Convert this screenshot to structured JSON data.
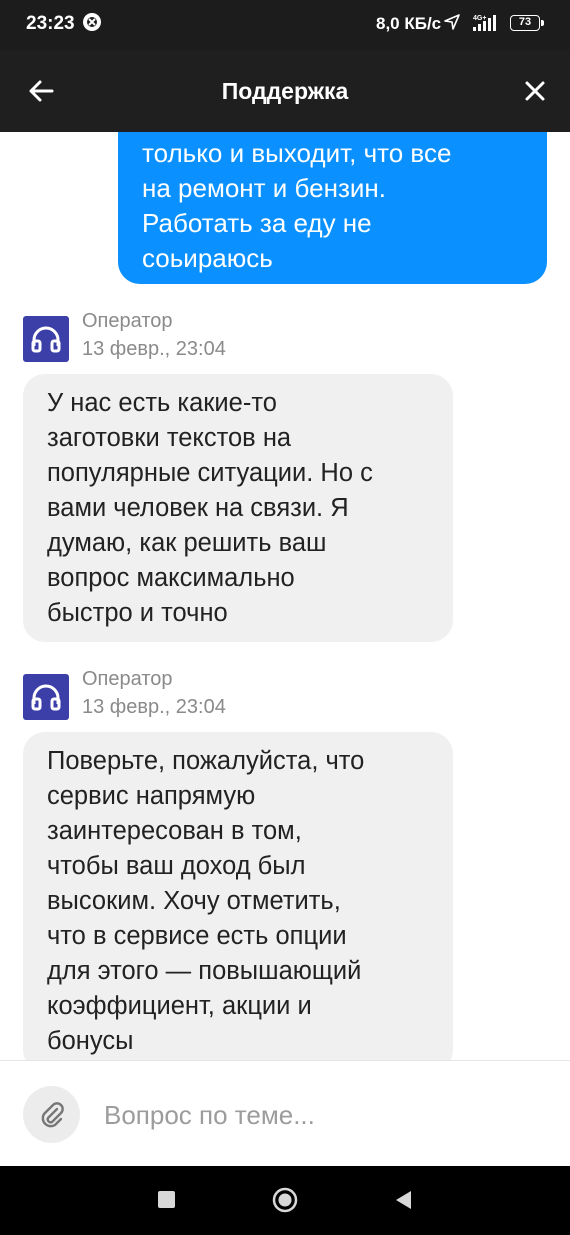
{
  "status_bar": {
    "time": "23:23",
    "speed": "8,0 КБ/с",
    "network": "4G+",
    "battery": "73",
    "icons": [
      "notification-icon",
      "location-arrow-icon",
      "signal-icon",
      "battery-icon"
    ]
  },
  "header": {
    "title": "Поддержка",
    "back_icon": "arrow-left-icon",
    "close_icon": "close-icon",
    "background": "#1f1f1f"
  },
  "messages": {
    "user": {
      "lines": [
        "только и выходит, что все",
        "на ремонт и бензин.",
        "Работать за еду не",
        "соьираюсь"
      ],
      "color": "#0a91ff"
    },
    "operator": [
      {
        "name": "Оператор",
        "time": "13 февр., 23:04",
        "avatar_icon": "headphones-icon",
        "lines": [
          "У нас есть какие-то",
          "заготовки текстов на",
          "популярные ситуации. Но с",
          "вами человек на связи. Я",
          "думаю, как решить ваш",
          "вопрос максимально",
          "быстро и точно"
        ]
      },
      {
        "name": "Оператор",
        "time": "13 февр., 23:04",
        "avatar_icon": "headphones-icon",
        "lines": [
          "Поверьте, пожалуйста, что",
          "сервис напрямую",
          "заинтересован в том,",
          "чтобы ваш доход был",
          "высоким. Хочу отметить,",
          "что в сервисе есть опции",
          "для этого — повышающий",
          "коэффициент, акции и",
          "бонусы"
        ]
      }
    ]
  },
  "input": {
    "placeholder": "Вопрос по теме...",
    "value": "",
    "attach_icon": "paperclip-icon"
  },
  "nav_bar": {
    "icons": [
      "recents-square-icon",
      "home-circle-icon",
      "back-triangle-icon"
    ]
  }
}
